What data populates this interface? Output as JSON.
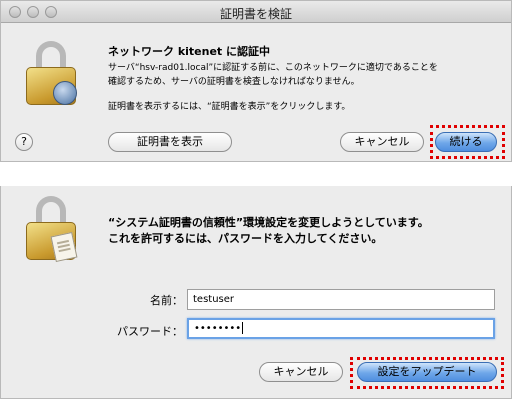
{
  "dialog1": {
    "window_title": "証明書を検証",
    "heading": "ネットワーク kitenet に認証中",
    "body_lines": [
      "サーバ“hsv-rad01.local”に認証する前に、このネットワークに適切であることを",
      "確認するため、サーバの証明書を検査しなければなりません。"
    ],
    "instruction": "証明書を表示するには、“証明書を表示”をクリックします。",
    "help_label": "?",
    "show_cert_label": "証明書を表示",
    "cancel_label": "キャンセル",
    "continue_label": "続ける"
  },
  "dialog2": {
    "heading_lines": [
      "“システム証明書の信頼性”環境設定を変更しようとしています。",
      "これを許可するには、パスワードを入力してください。"
    ],
    "name_label": "名前：",
    "name_value": "testuser",
    "password_label": "パスワード：",
    "password_value": "••••••••",
    "cancel_label": "キャンセル",
    "update_label": "設定をアップデート"
  },
  "colors": {
    "highlight": "#e00000",
    "primary_button": "#4f8edf",
    "focus_ring": "#6aa2e6"
  }
}
